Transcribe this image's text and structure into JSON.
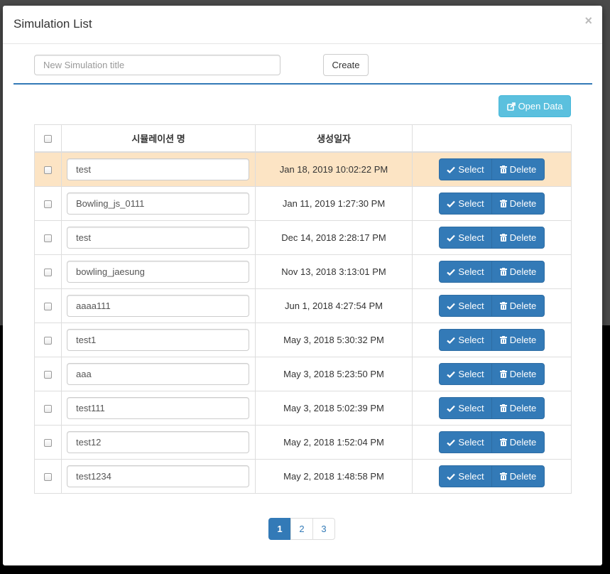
{
  "modal": {
    "title": "Simulation List",
    "close_label": "×"
  },
  "create_form": {
    "placeholder": "New Simulation title",
    "value": "",
    "create_label": "Create"
  },
  "open_data": {
    "label": "Open Data",
    "icon": "external-link-icon"
  },
  "table": {
    "headers": {
      "name": "시뮬레이션 명",
      "created": "생성일자"
    },
    "select_label": "Select",
    "delete_label": "Delete",
    "select_icon": "check-icon",
    "delete_icon": "trash-icon",
    "rows": [
      {
        "name": "test",
        "created": "Jan 18, 2019 10:02:22 PM",
        "highlighted": true
      },
      {
        "name": "Bowling_js_0111",
        "created": "Jan 11, 2019 1:27:30 PM",
        "highlighted": false
      },
      {
        "name": "test",
        "created": "Dec 14, 2018 2:28:17 PM",
        "highlighted": false
      },
      {
        "name": "bowling_jaesung",
        "created": "Nov 13, 2018 3:13:01 PM",
        "highlighted": false
      },
      {
        "name": "aaaa111",
        "created": "Jun 1, 2018 4:27:54 PM",
        "highlighted": false
      },
      {
        "name": "test1",
        "created": "May 3, 2018 5:30:32 PM",
        "highlighted": false
      },
      {
        "name": "aaa",
        "created": "May 3, 2018 5:23:50 PM",
        "highlighted": false
      },
      {
        "name": "test111",
        "created": "May 3, 2018 5:02:39 PM",
        "highlighted": false
      },
      {
        "name": "test12",
        "created": "May 2, 2018 1:52:04 PM",
        "highlighted": false
      },
      {
        "name": "test1234",
        "created": "May 2, 2018 1:48:58 PM",
        "highlighted": false
      }
    ]
  },
  "pagination": {
    "pages": [
      "1",
      "2",
      "3"
    ],
    "active": "1"
  },
  "colors": {
    "primary": "#337ab7",
    "info": "#5bc0de",
    "row_highlight": "#fce4c4"
  }
}
